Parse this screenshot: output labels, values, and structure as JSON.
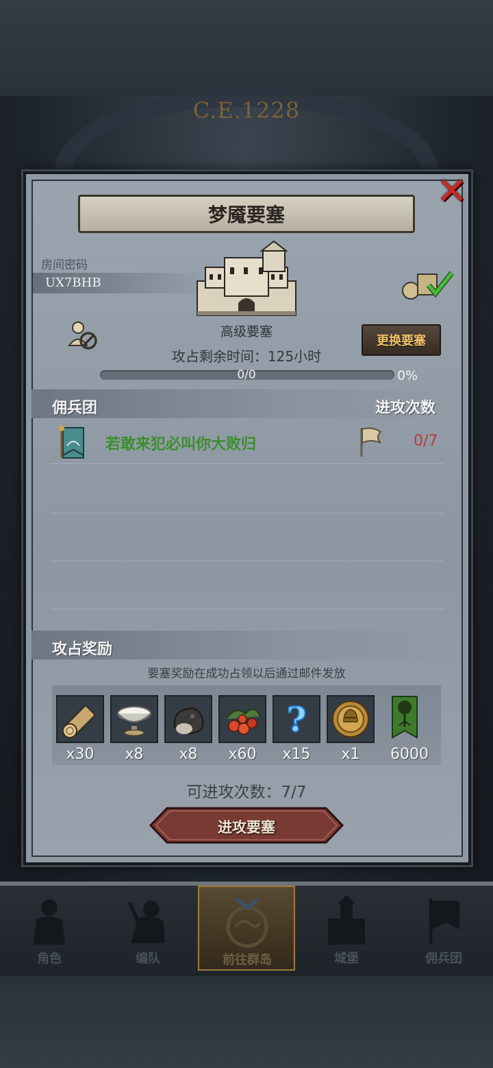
{
  "header": {
    "era": "C.E.1228"
  },
  "dialog": {
    "title": "梦魇要塞",
    "close_icon": "close-icon",
    "room_label": "房间密码",
    "room_code": "UX7BHB",
    "fortress_grade": "高级要塞",
    "time_label": "攻占剩余时间：",
    "time_value": "125小时",
    "change_button": "更换要塞",
    "progress": {
      "text": "0/0",
      "percent_text": "0%",
      "fraction": 0
    },
    "mercenary_header": "佣兵团",
    "attacks_header": "进攻次数",
    "mercenaries": [
      {
        "name": "若敢来犯必叫你大败归",
        "attacks": "0/7"
      }
    ],
    "rewards_header": "攻占奖励",
    "reward_note": "要塞奖励在成功占领以后通过邮件发放",
    "rewards": [
      {
        "icon": "wood-log-icon",
        "qty": "x30"
      },
      {
        "icon": "silver-bowl-icon",
        "qty": "x8"
      },
      {
        "icon": "ore-stone-icon",
        "qty": "x8"
      },
      {
        "icon": "berries-icon",
        "qty": "x60"
      },
      {
        "icon": "mystery-question-icon",
        "qty": "x15"
      },
      {
        "icon": "knight-medal-icon",
        "qty": "x1"
      },
      {
        "icon": "tree-banner-icon",
        "qty": "6000"
      }
    ],
    "attack_count_label": "可进攻次数：",
    "attack_count_value": "7/7",
    "attack_button": "进攻要塞"
  },
  "nav": {
    "items": [
      {
        "label": "角色",
        "icon": "character-icon"
      },
      {
        "label": "编队",
        "icon": "formation-icon"
      },
      {
        "label": "前往群岛",
        "icon": "island-map-icon",
        "active": true
      },
      {
        "label": "城堡",
        "icon": "castle-icon"
      },
      {
        "label": "佣兵团",
        "icon": "mercenary-icon"
      }
    ]
  },
  "colors": {
    "accent_gold": "#f1c36b",
    "merc_name_green": "#3b8e2f",
    "attacks_red": "#b63c35",
    "close_red": "#c62a22"
  }
}
